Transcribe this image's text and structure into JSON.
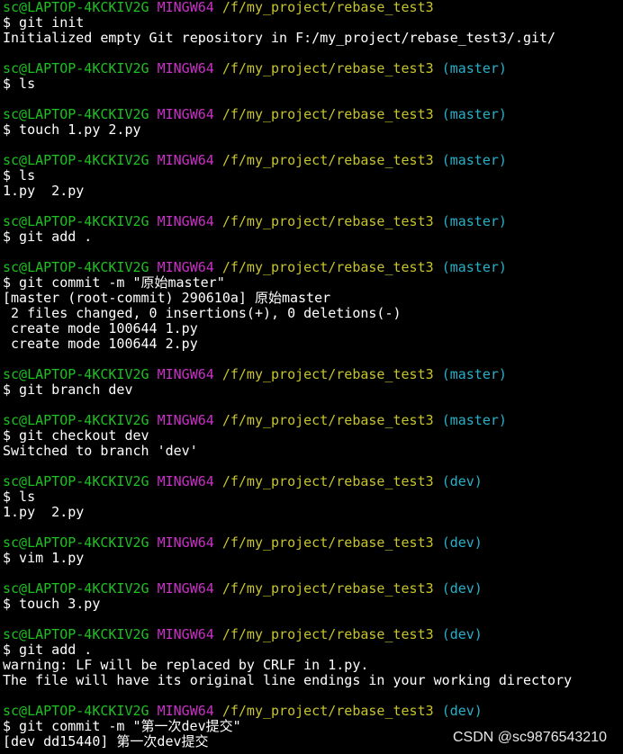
{
  "terminal": {
    "colors": {
      "background": "#000000",
      "text": "#ffffff",
      "user": "#1dc121",
      "system": "#c930c7",
      "path": "#c7c42c",
      "branch": "#27b0c8"
    },
    "prompt": {
      "user": "sc@LAPTOP-4KCKIV2G",
      "system": "MINGW64",
      "path": "/f/my_project/rebase_test3"
    },
    "blocks": [
      {
        "branch": "",
        "command": "$ git init",
        "output": [
          "Initialized empty Git repository in F:/my_project/rebase_test3/.git/"
        ]
      },
      {
        "branch": "(master)",
        "command": "$ ls",
        "output": []
      },
      {
        "branch": "(master)",
        "command": "$ touch 1.py 2.py",
        "output": []
      },
      {
        "branch": "(master)",
        "command": "$ ls",
        "output": [
          "1.py  2.py"
        ]
      },
      {
        "branch": "(master)",
        "command": "$ git add .",
        "output": []
      },
      {
        "branch": "(master)",
        "command": "$ git commit -m \"原始master\"",
        "output": [
          "[master (root-commit) 290610a] 原始master",
          " 2 files changed, 0 insertions(+), 0 deletions(-)",
          " create mode 100644 1.py",
          " create mode 100644 2.py"
        ]
      },
      {
        "branch": "(master)",
        "command": "$ git branch dev",
        "output": []
      },
      {
        "branch": "(master)",
        "command": "$ git checkout dev",
        "output": [
          "Switched to branch 'dev'"
        ]
      },
      {
        "branch": "(dev)",
        "command": "$ ls",
        "output": [
          "1.py  2.py"
        ]
      },
      {
        "branch": "(dev)",
        "command": "$ vim 1.py",
        "output": []
      },
      {
        "branch": "(dev)",
        "command": "$ touch 3.py",
        "output": []
      },
      {
        "branch": "(dev)",
        "command": "$ git add .",
        "output": [
          "warning: LF will be replaced by CRLF in 1.py.",
          "The file will have its original line endings in your working directory"
        ]
      },
      {
        "branch": "(dev)",
        "command": "$ git commit -m \"第一次dev提交\"",
        "output": [
          "[dev dd15440] 第一次dev提交"
        ]
      }
    ]
  },
  "watermark": {
    "text": "CSDN @sc9876543210"
  }
}
